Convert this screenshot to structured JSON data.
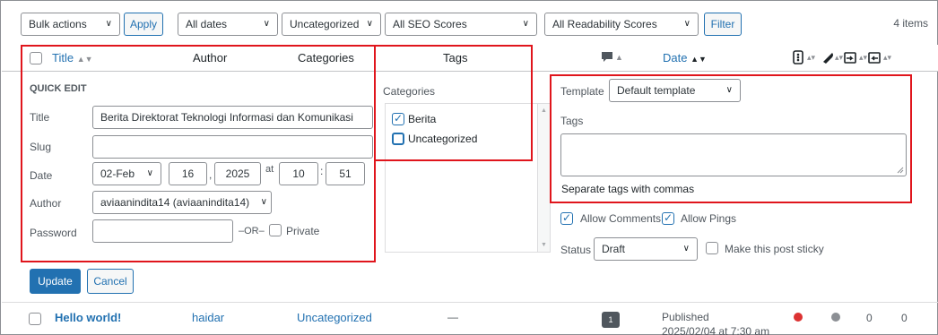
{
  "toolbar": {
    "bulk_actions": "Bulk actions",
    "apply": "Apply",
    "dates": "All dates",
    "category_filter": "Uncategorized",
    "seo": "All SEO Scores",
    "readability": "All Readability Scores",
    "filter": "Filter",
    "item_count": "4 items"
  },
  "columns": {
    "title": "Title",
    "author": "Author",
    "categories": "Categories",
    "tags": "Tags",
    "date": "Date"
  },
  "quick_edit": {
    "heading": "QUICK EDIT",
    "title_label": "Title",
    "title_value": "Berita Direktorat Teknologi Informasi dan Komunikasi",
    "slug_label": "Slug",
    "slug_value": "",
    "date_label": "Date",
    "month": "02-Feb",
    "day": "16",
    "year": "2025",
    "at": "at",
    "hour": "10",
    "minute": "51",
    "comma": ",",
    "colon": ":",
    "author_label": "Author",
    "author_value": "aviaanindita14 (aviaanindita14)",
    "password_label": "Password",
    "password_value": "",
    "or": "–OR–",
    "private": "Private",
    "categories_label": "Categories",
    "category_items": [
      {
        "label": "Berita",
        "checked": true
      },
      {
        "label": "Uncategorized",
        "checked": false
      }
    ],
    "template_label": "Template",
    "template_value": "Default template",
    "tags_label": "Tags",
    "tags_hint": "Separate tags with commas",
    "allow_comments": "Allow Comments",
    "allow_pings": "Allow Pings",
    "status_label": "Status",
    "status_value": "Draft",
    "sticky": "Make this post sticky",
    "update": "Update",
    "cancel": "Cancel"
  },
  "row": {
    "title": "Hello world!",
    "author": "haidar",
    "category": "Uncategorized",
    "tags": "—",
    "comments": "1",
    "status": "Published",
    "datetime": "2025/02/04 at 7:30 am",
    "count1": "0",
    "count2": "0"
  },
  "colors": {
    "accent": "#2271b1",
    "highlight": "#e0151c",
    "seo_dot": "#dc3232",
    "readability_dot": "#8c8f94"
  }
}
